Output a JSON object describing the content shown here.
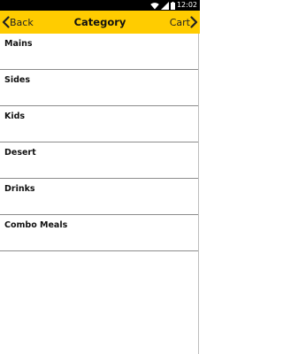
{
  "status_bar": {
    "time": "12:02",
    "icons": [
      "wifi-icon",
      "signal-icon",
      "battery-icon"
    ]
  },
  "nav": {
    "back_label": "Back",
    "title": "Category",
    "cart_label": "Cart",
    "accent_color": "#ffcc00"
  },
  "categories": [
    {
      "label": "Mains"
    },
    {
      "label": "Sides"
    },
    {
      "label": "Kids"
    },
    {
      "label": "Desert"
    },
    {
      "label": "Drinks"
    },
    {
      "label": "Combo Meals"
    }
  ]
}
